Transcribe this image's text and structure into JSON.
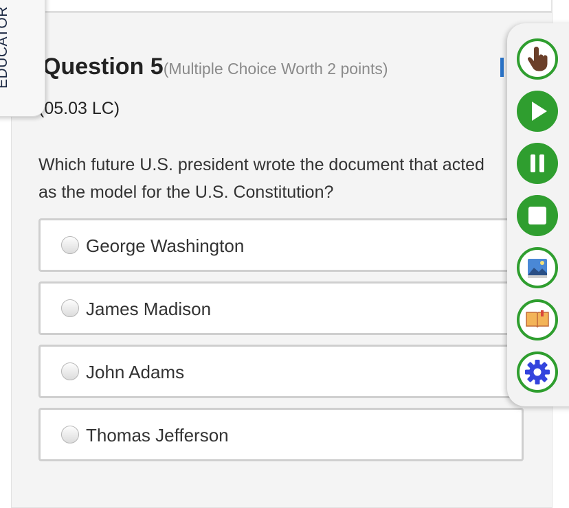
{
  "sidebar": {
    "educator_label": "EDUCATOR"
  },
  "question": {
    "title": "Question 5",
    "worth": "(Multiple Choice Worth 2 points)",
    "code": "(05.03 LC)",
    "text": "Which future U.S. president wrote the document that acted as the model for the U.S. Constitution?"
  },
  "choices": [
    {
      "label": "George Washington",
      "selected": false
    },
    {
      "label": "James Madison",
      "selected": false
    },
    {
      "label": "John Adams",
      "selected": false
    },
    {
      "label": "Thomas Jefferson",
      "selected": false
    }
  ],
  "toolbar": {
    "tools": [
      "hand-pointer-icon",
      "play-icon",
      "pause-icon",
      "stop-icon",
      "image-icon",
      "book-icon",
      "gear-icon"
    ]
  },
  "colors": {
    "tool_green": "#2f9e2f",
    "gear_blue": "#3344dd",
    "panel_bg": "#f4f4f4",
    "educator_text": "#1d2a44",
    "pin_blue": "#2b74c8"
  }
}
